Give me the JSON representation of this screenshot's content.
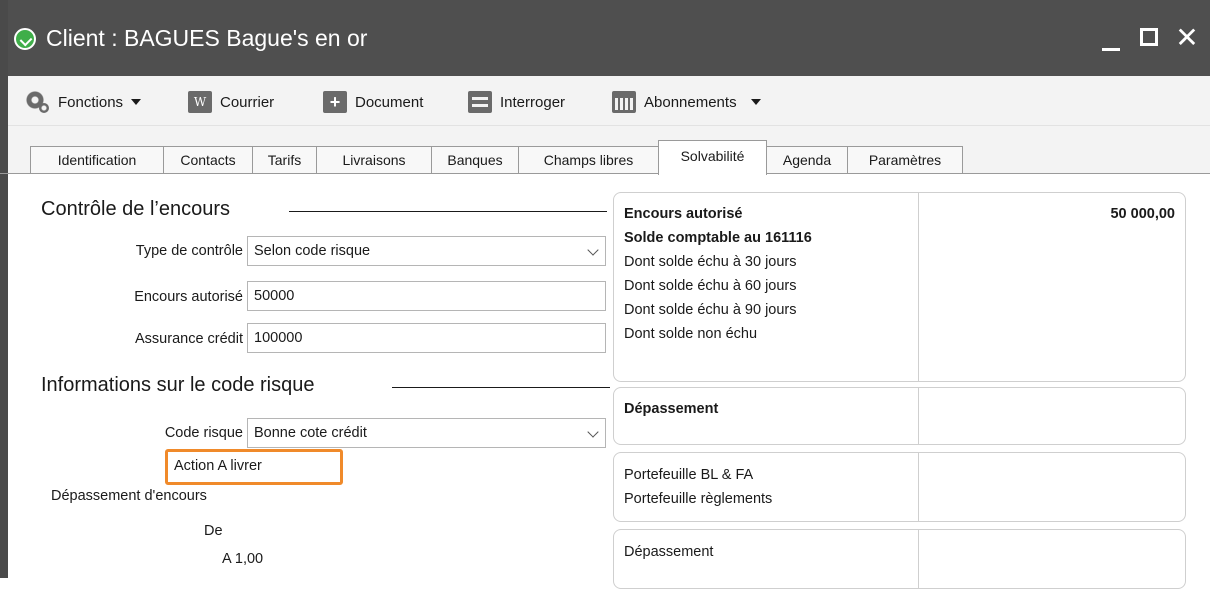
{
  "window": {
    "title": "Client : BAGUES Bague's en or",
    "controls": {
      "minimize": "_",
      "maximize": "□",
      "close": "✕"
    }
  },
  "toolbar": {
    "items": [
      {
        "label": "Fonctions",
        "icon": "gear-icon",
        "dropdown": true
      },
      {
        "label": "Courrier",
        "icon": "word-icon",
        "dropdown": false
      },
      {
        "label": "Document",
        "icon": "add-document-icon",
        "dropdown": false
      },
      {
        "label": "Interroger",
        "icon": "query-icon",
        "dropdown": false
      },
      {
        "label": "Abonnements",
        "icon": "calendar-icon",
        "dropdown": true
      }
    ]
  },
  "tabs": [
    {
      "label": "Identification"
    },
    {
      "label": "Contacts"
    },
    {
      "label": "Tarifs"
    },
    {
      "label": "Livraisons"
    },
    {
      "label": "Banques"
    },
    {
      "label": "Champs libres"
    },
    {
      "label": "Solvabilité",
      "active": true
    },
    {
      "label": "Agenda"
    },
    {
      "label": "Paramètres"
    }
  ],
  "encours": {
    "title": "Contrôle de l’encours",
    "type_controle_label": "Type de contrôle",
    "type_controle_value": "Selon code risque",
    "encours_autorise_label": "Encours autorisé",
    "encours_autorise_value": "50000",
    "assurance_label": "Assurance crédit",
    "assurance_value": "100000"
  },
  "risque": {
    "title": "Informations sur le code risque",
    "code_label": "Code risque",
    "code_value": "Bonne cote crédit",
    "action_text": "Action A livrer",
    "depassement_label": "Dépassement d'encours",
    "de_text": "De",
    "a_text": "A 1,00"
  },
  "summary": {
    "panel1": {
      "lines": [
        "Encours autorisé",
        "Solde comptable au 161116",
        "Dont solde échu à 30 jours",
        "Dont solde échu à 60 jours",
        "Dont solde échu à 90 jours",
        "Dont solde non échu"
      ],
      "value": "50 000,00"
    },
    "panel2": {
      "line": "Dépassement"
    },
    "panel3": {
      "lines": [
        "Portefeuille BL & FA",
        "Portefeuille règlements"
      ]
    },
    "panel4": {
      "line": "Dépassement"
    }
  },
  "colors": {
    "titlebar": "#4f4f4f",
    "logo": "#3fae49",
    "highlight": "#f08a2a"
  }
}
